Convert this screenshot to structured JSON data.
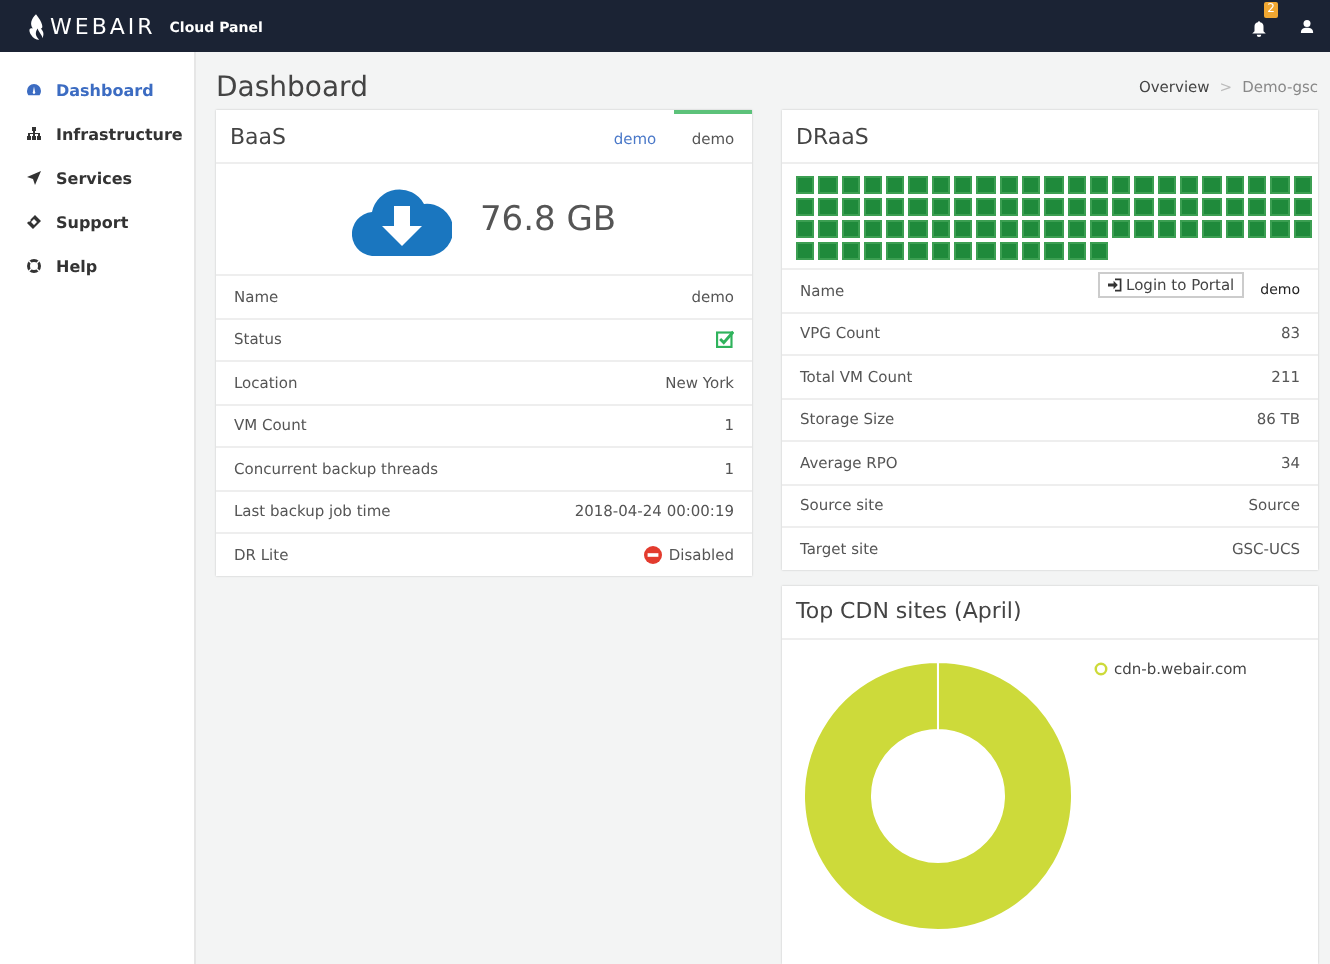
{
  "header": {
    "logo": "WEBAIR",
    "product": "Cloud Panel",
    "notifications": "2"
  },
  "sidebar": {
    "items": [
      {
        "label": "Dashboard",
        "selected": true
      },
      {
        "label": "Infrastructure",
        "selected": false
      },
      {
        "label": "Services",
        "selected": false
      },
      {
        "label": "Support",
        "selected": false
      },
      {
        "label": "Help",
        "selected": false
      }
    ]
  },
  "page": {
    "title": "Dashboard",
    "breadcrumb": [
      "Overview",
      "Demo-gsc"
    ],
    "separator": ">"
  },
  "baas": {
    "title": "BaaS",
    "tabs": [
      {
        "label": "demo",
        "selected": false
      },
      {
        "label": "demo",
        "selected": true
      }
    ],
    "usage": "76.8 GB",
    "rows": [
      {
        "label": "Name",
        "kind": "text",
        "value": "demo"
      },
      {
        "label": "Status",
        "kind": "check",
        "checked": true
      },
      {
        "label": "Location",
        "kind": "text",
        "value": "New York"
      },
      {
        "label": "VM Count",
        "kind": "text",
        "value": "1"
      },
      {
        "label": "Concurrent backup threads",
        "kind": "text",
        "value": "1"
      },
      {
        "label": "Last backup job time",
        "kind": "text",
        "value": "2018-04-24 00:00:19"
      },
      {
        "label": "DR Lite",
        "kind": "status",
        "value": "Disabled",
        "enabled": false
      }
    ]
  },
  "draas": {
    "title": "DRaaS",
    "vpg_tiles": [
      {
        "healthy": true
      },
      {
        "healthy": true
      },
      {
        "healthy": true
      },
      {
        "healthy": true
      },
      {
        "healthy": true
      },
      {
        "healthy": true
      },
      {
        "healthy": true
      },
      {
        "healthy": true
      },
      {
        "healthy": true
      },
      {
        "healthy": true
      },
      {
        "healthy": true
      },
      {
        "healthy": true
      },
      {
        "healthy": true
      },
      {
        "healthy": true
      },
      {
        "healthy": true
      },
      {
        "healthy": true
      },
      {
        "healthy": true
      },
      {
        "healthy": true
      },
      {
        "healthy": true
      },
      {
        "healthy": true
      },
      {
        "healthy": true
      },
      {
        "healthy": true
      },
      {
        "healthy": true
      },
      {
        "healthy": true
      },
      {
        "healthy": true
      },
      {
        "healthy": true
      },
      {
        "healthy": true
      },
      {
        "healthy": true
      },
      {
        "healthy": true
      },
      {
        "healthy": true
      },
      {
        "healthy": true
      },
      {
        "healthy": true
      },
      {
        "healthy": true
      },
      {
        "healthy": true
      },
      {
        "healthy": true
      },
      {
        "healthy": true
      },
      {
        "healthy": true
      },
      {
        "healthy": true
      },
      {
        "healthy": true
      },
      {
        "healthy": true
      },
      {
        "healthy": true
      },
      {
        "healthy": true
      },
      {
        "healthy": true
      },
      {
        "healthy": true
      },
      {
        "healthy": true
      },
      {
        "healthy": true
      },
      {
        "healthy": true
      },
      {
        "healthy": true
      },
      {
        "healthy": true
      },
      {
        "healthy": true
      },
      {
        "healthy": true
      },
      {
        "healthy": true
      },
      {
        "healthy": true
      },
      {
        "healthy": true
      },
      {
        "healthy": true
      },
      {
        "healthy": true
      },
      {
        "healthy": true
      },
      {
        "healthy": true
      },
      {
        "healthy": true
      },
      {
        "healthy": true
      },
      {
        "healthy": true
      },
      {
        "healthy": true
      },
      {
        "healthy": true
      },
      {
        "healthy": true
      },
      {
        "healthy": true
      },
      {
        "healthy": true
      },
      {
        "healthy": true
      },
      {
        "healthy": true
      },
      {
        "healthy": true
      },
      {
        "healthy": true
      },
      {
        "healthy": true
      },
      {
        "healthy": true
      },
      {
        "healthy": true
      },
      {
        "healthy": true
      },
      {
        "healthy": true
      },
      {
        "healthy": true
      },
      {
        "healthy": true
      },
      {
        "healthy": true
      },
      {
        "healthy": true
      },
      {
        "healthy": true
      },
      {
        "healthy": true
      },
      {
        "healthy": true
      },
      {
        "healthy": true
      }
    ],
    "rows": [
      {
        "label": "Name",
        "kind": "portal",
        "button": "Login to Portal",
        "value": "demo"
      },
      {
        "label": "VPG Count",
        "kind": "text",
        "value": "83"
      },
      {
        "label": "Total VM Count",
        "kind": "text",
        "value": "211"
      },
      {
        "label": "Storage Size",
        "kind": "text",
        "value": "86 TB"
      },
      {
        "label": "Average RPO",
        "kind": "text",
        "value": "34"
      },
      {
        "label": "Source site",
        "kind": "text",
        "value": "Source"
      },
      {
        "label": "Target site",
        "kind": "text",
        "value": "GSC-UCS"
      }
    ]
  },
  "cdn": {
    "title": "Top CDN sites (April)",
    "legend": [
      {
        "label": "cdn-b.webair.com",
        "color": "#cdda3a"
      }
    ]
  }
}
